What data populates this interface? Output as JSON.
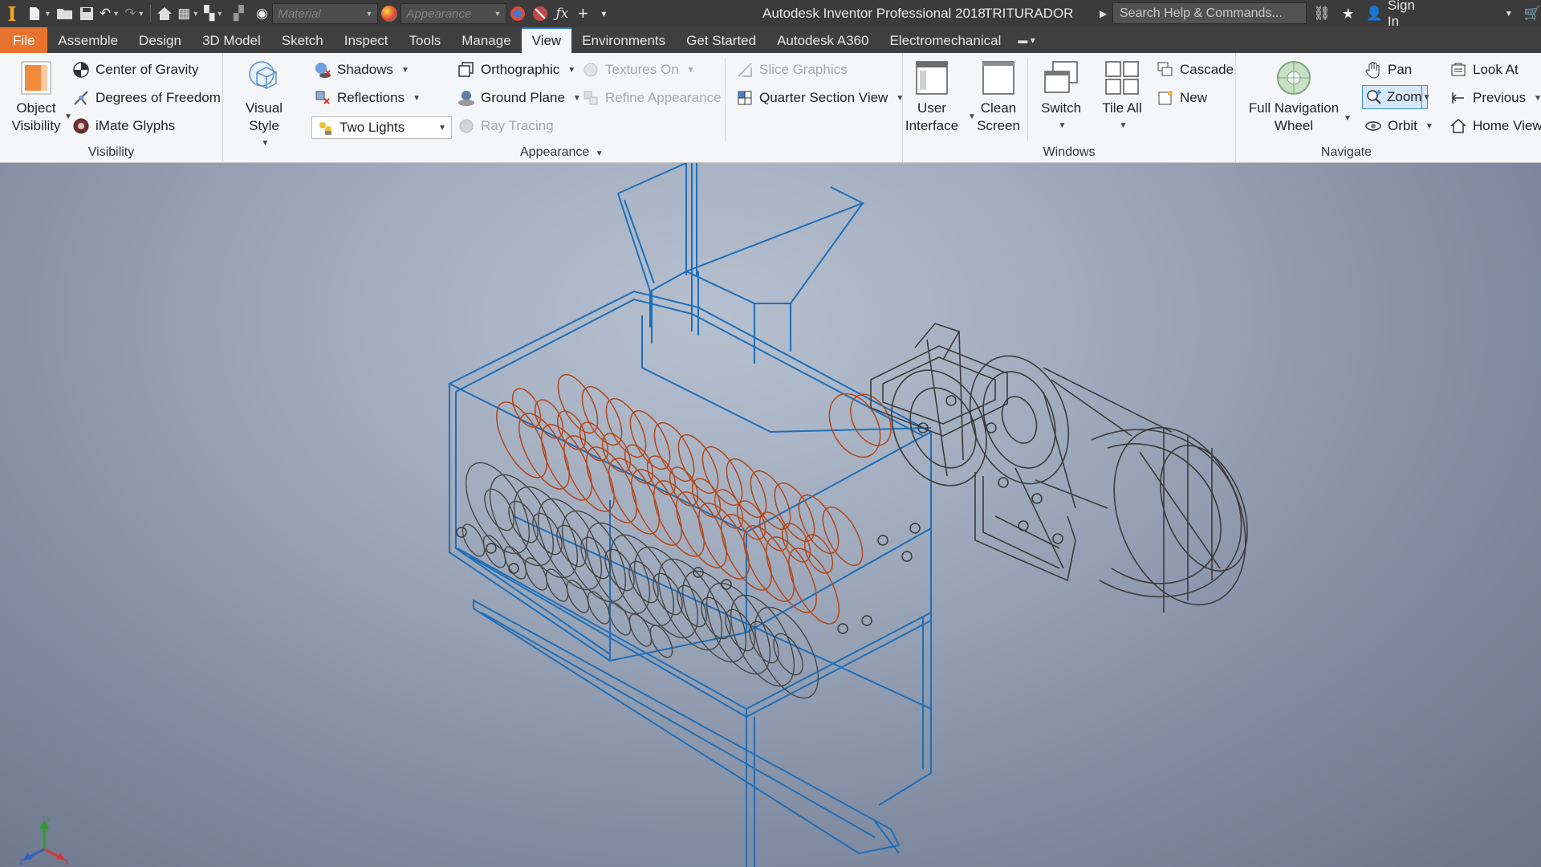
{
  "titlebar": {
    "logo": "I",
    "material_placeholder": "Material",
    "appearance_placeholder": "Appearance",
    "app_title": "Autodesk Inventor Professional 2018",
    "document_title": "TRITURADOR",
    "search_placeholder": "Search Help & Commands...",
    "sign_in": "Sign In"
  },
  "tabs": [
    "File",
    "Assemble",
    "Design",
    "3D Model",
    "Sketch",
    "Inspect",
    "Tools",
    "Manage",
    "View",
    "Environments",
    "Get Started",
    "Autodesk A360",
    "Electromechanical"
  ],
  "active_tab": "View",
  "ribbon": {
    "visibility": {
      "label": "Visibility",
      "object_visibility_line1": "Object",
      "object_visibility_line2": "Visibility",
      "center_of_gravity": "Center of Gravity",
      "degrees_of_freedom": "Degrees of Freedom",
      "imate_glyphs": "iMate Glyphs"
    },
    "appearance": {
      "label": "Appearance",
      "visual_style": "Visual Style",
      "shadows": "Shadows",
      "reflections": "Reflections",
      "lighting": "Two Lights",
      "orthographic": "Orthographic",
      "ground_plane": "Ground Plane",
      "ray_tracing": "Ray Tracing",
      "textures_on": "Textures On",
      "refine_appearance": "Refine Appearance",
      "slice_graphics": "Slice Graphics",
      "quarter_section_view": "Quarter Section View"
    },
    "windows": {
      "label": "Windows",
      "user_interface_line1": "User",
      "user_interface_line2": "Interface",
      "clean_screen_line1": "Clean",
      "clean_screen_line2": "Screen",
      "switch": "Switch",
      "tile_all": "Tile All",
      "cascade": "Cascade",
      "new": "New"
    },
    "navigate": {
      "label": "Navigate",
      "full_nav_line1": "Full Navigation",
      "full_nav_line2": "Wheel",
      "pan": "Pan",
      "zoom": "Zoom",
      "orbit": "Orbit",
      "look_at": "Look At",
      "previous": "Previous",
      "home_view": "Home View"
    }
  },
  "viewport": {
    "axis_labels": {
      "x": "X",
      "y": "Y",
      "z": "Z"
    }
  },
  "colors": {
    "frame_wireframe": "#1f6fb8",
    "rotor_wireframe": "#b4481b",
    "motor_wireframe": "#3c3c3c",
    "file_tab": "#e8732f",
    "accent_blue": "#2b7bd6"
  }
}
